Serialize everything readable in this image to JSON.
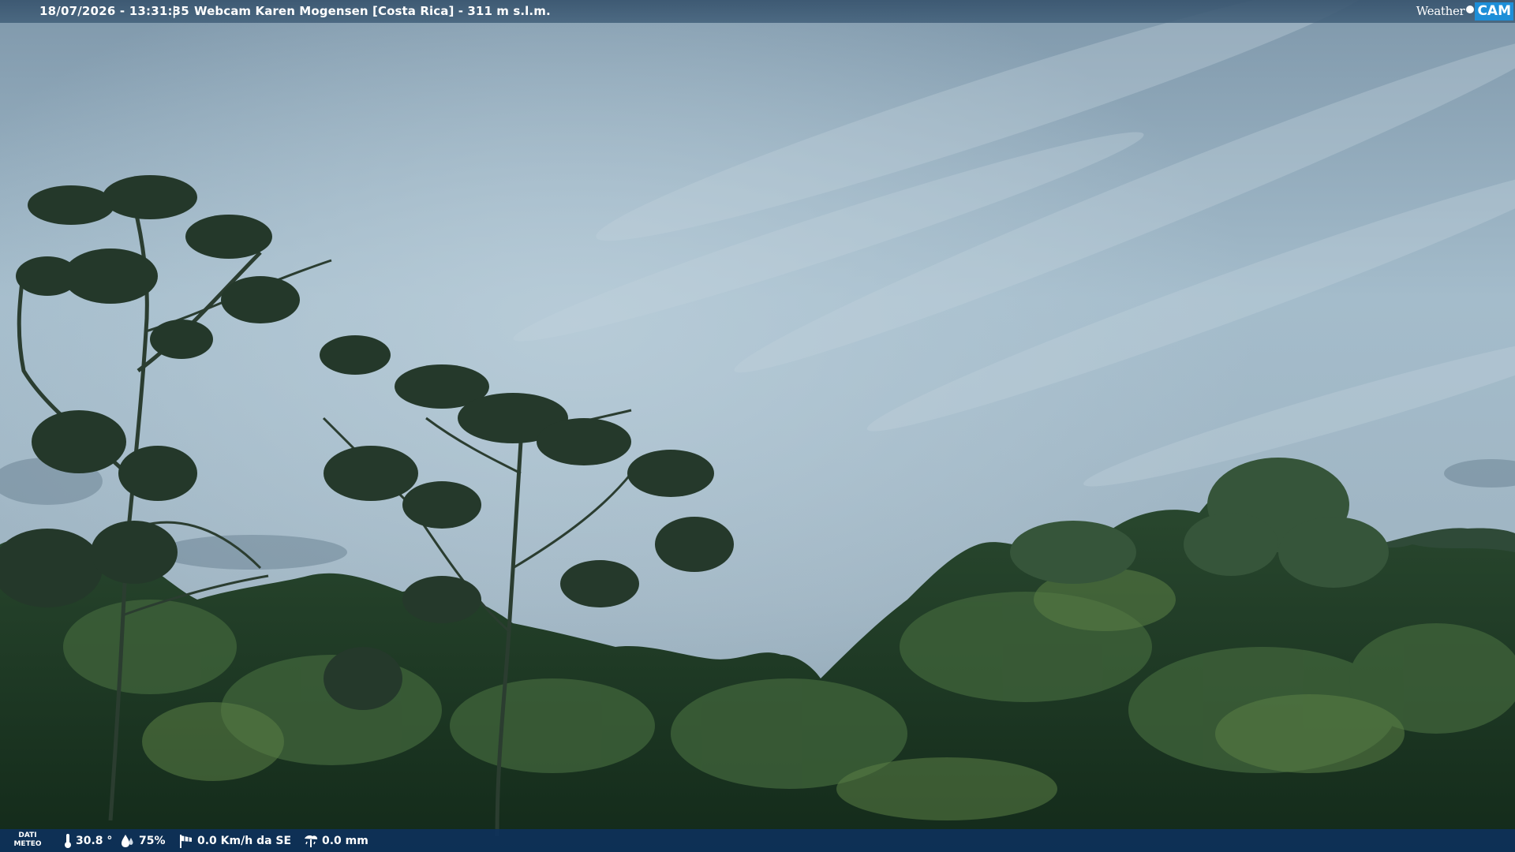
{
  "overlay": {
    "timestamp": "18/07/2026 - 13:31:35",
    "separator": "|",
    "title": "Webcam Karen Mogensen [Costa Rica]  - 311 m s.l.m.",
    "brand": {
      "weather": "Weather",
      "cam": "CAM"
    }
  },
  "weather_bar": {
    "label_line1": "DATI",
    "label_line2": "METEO",
    "temperature": "30.8 °",
    "humidity": "75%",
    "wind": "0.0 Km/h da SE",
    "rain": "0.0 mm"
  },
  "icons": {
    "temperature": "thermometer-icon",
    "humidity": "humidity-drop-icon",
    "wind": "windsock-icon",
    "rain": "rain-gauge-icon"
  },
  "colors": {
    "top_bar": "#3f5f7f",
    "bottom_bar": "#0d315c",
    "brand_cam": "#1e8fd8",
    "sky": "#9fb6c6",
    "forest": "#1f3a25"
  }
}
